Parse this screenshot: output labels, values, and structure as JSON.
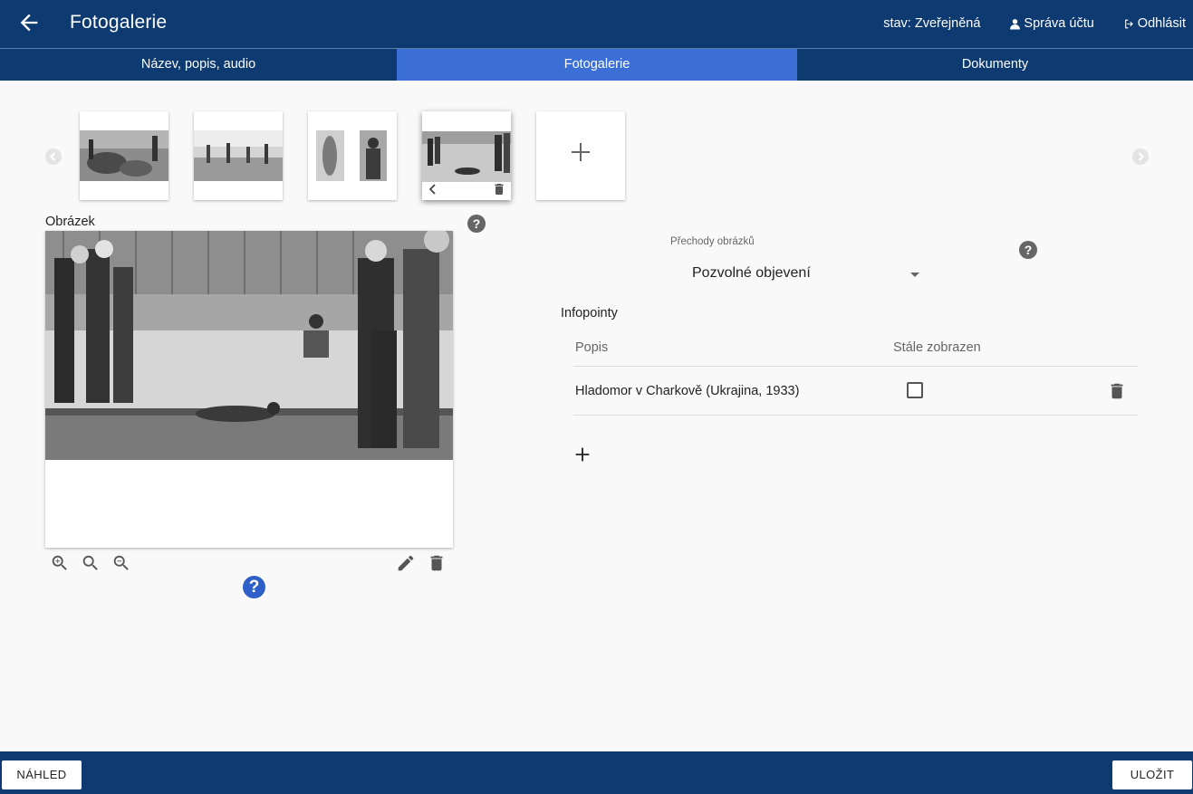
{
  "header": {
    "title": "Fotogalerie",
    "status": "stav: Zveřejněná",
    "account": "Správa účtu",
    "logout": "Odhlásit"
  },
  "tabs": [
    {
      "label": "Název, popis, audio",
      "active": false
    },
    {
      "label": "Fotogalerie",
      "active": true
    },
    {
      "label": "Dokumenty",
      "active": false
    }
  ],
  "gallery": {
    "selected_index": 3
  },
  "image_section": {
    "label": "Obrázek",
    "help_symbol": "?",
    "infopoint_symbol": "?"
  },
  "transitions": {
    "label": "Přechody obrázků",
    "value": "Pozvolné objevení"
  },
  "infopoints": {
    "title": "Infopointy",
    "columns": [
      "Popis",
      "Stále zobrazen"
    ],
    "rows": [
      {
        "description": "Hladomor v Charkově (Ukrajina, 1933)",
        "always_shown": false
      }
    ]
  },
  "footer": {
    "preview": "NÁHLED",
    "save": "ULOŽIT"
  },
  "colors": {
    "primary": "#0e3a72",
    "active_tab": "#3b6fd6",
    "infopoint": "#2f5fc9"
  }
}
